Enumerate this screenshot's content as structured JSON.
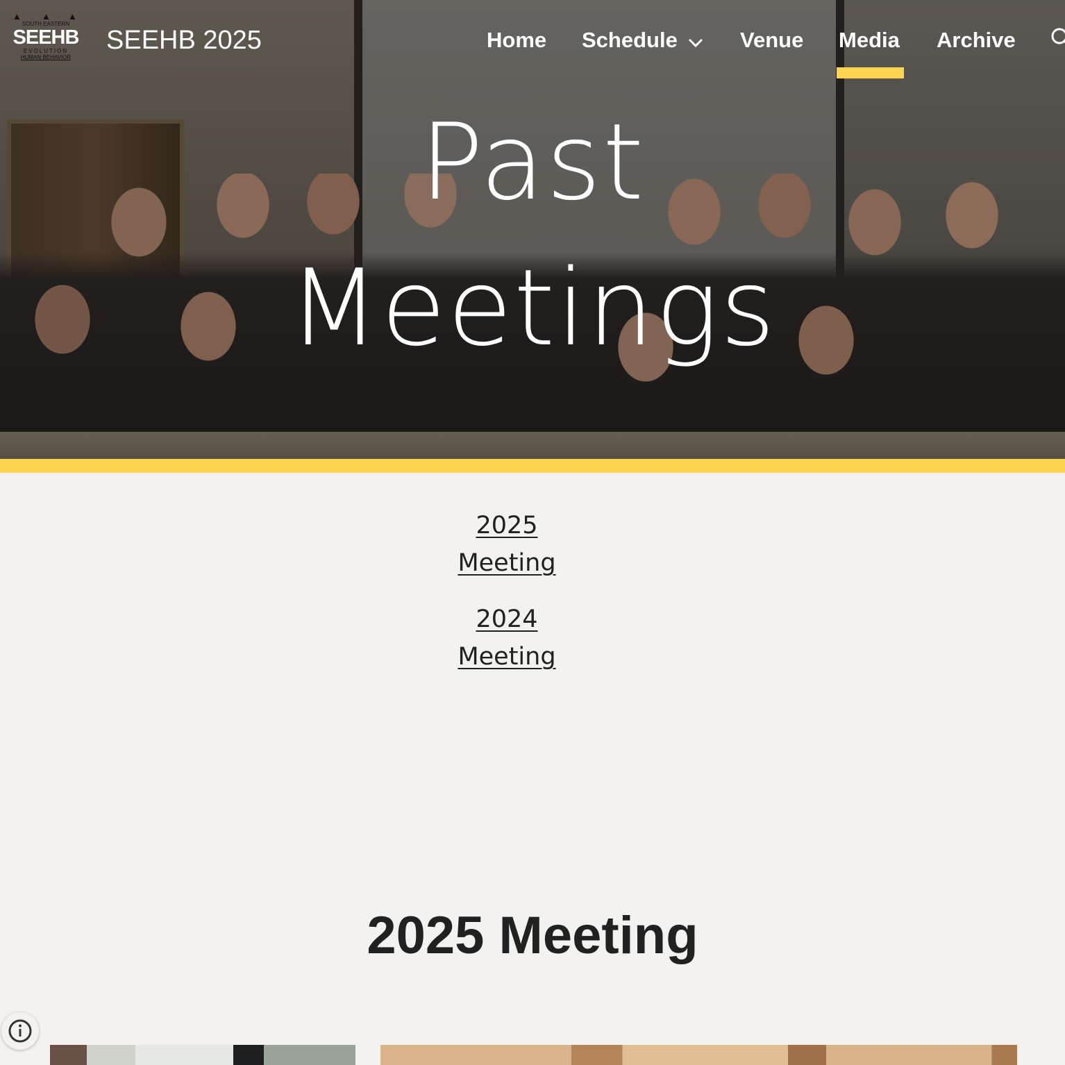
{
  "header": {
    "logo": {
      "big_text": "SEEHB",
      "top_text": "SOUTH EASTERN",
      "mid_text": "EVOLUTION",
      "bottom_text": "HUMAN BEHAVIOR"
    },
    "site_title": "SEEHB 2025",
    "nav": {
      "home": "Home",
      "schedule": "Schedule",
      "venue": "Venue",
      "media": "Media",
      "archive": "Archive"
    },
    "active_nav": "Media",
    "accent_color": "#fdd54f"
  },
  "hero": {
    "title_line1": "Past",
    "title_line2": "Meetings"
  },
  "links": [
    {
      "line1": "2025",
      "line2": "Meeting"
    },
    {
      "line1": "2024",
      "line2": "Meeting"
    }
  ],
  "section": {
    "heading": "2025 Meeting"
  },
  "icons": {
    "schedule_dropdown": "chevron-down-icon",
    "search": "search-icon",
    "info": "info-icon"
  }
}
